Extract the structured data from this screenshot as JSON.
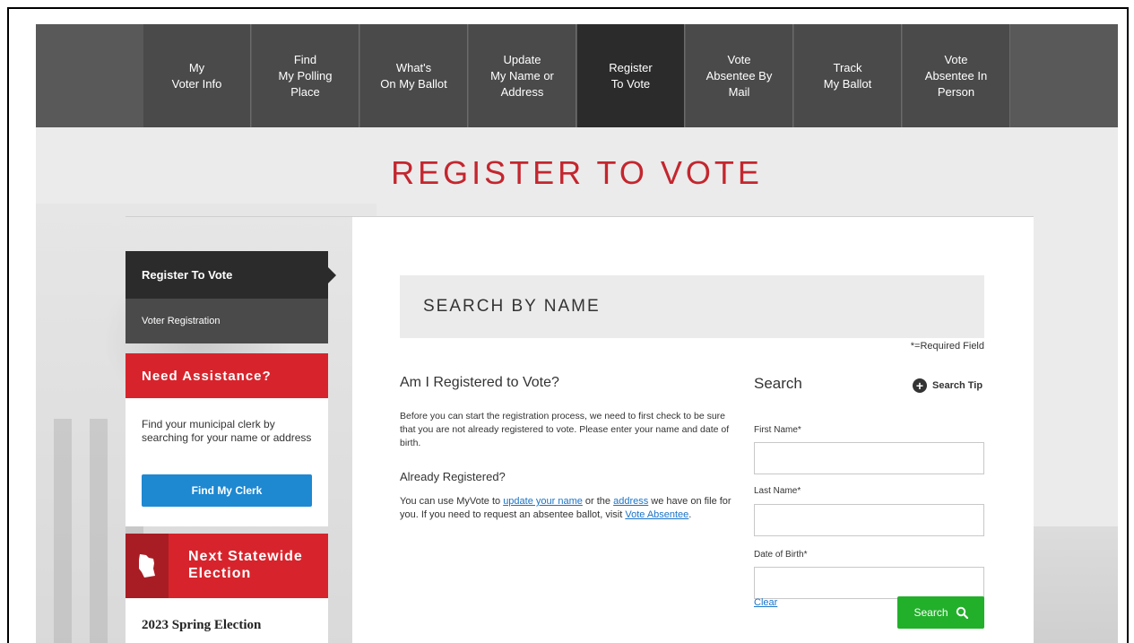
{
  "nav": [
    {
      "label": "My\nVoter Info",
      "active": false
    },
    {
      "label": "Find\nMy Polling\nPlace",
      "active": false
    },
    {
      "label": "What's\nOn My Ballot",
      "active": false
    },
    {
      "label": "Update\nMy Name or\nAddress",
      "active": false
    },
    {
      "label": "Register\nTo Vote",
      "active": true
    },
    {
      "label": "Vote\nAbsentee By\nMail",
      "active": false
    },
    {
      "label": "Track\nMy Ballot",
      "active": false
    },
    {
      "label": "Vote\nAbsentee In\nPerson",
      "active": false
    }
  ],
  "page_title": "REGISTER TO VOTE",
  "sidebar": {
    "active_item": "Register To Vote",
    "sub_item": "Voter Registration",
    "assistance": {
      "heading": "Need Assistance?",
      "text": "Find your municipal clerk by searching for your name or address",
      "button": "Find My Clerk"
    },
    "next_election": {
      "heading": "Next Statewide\nElection",
      "name": "2023 Spring Election"
    }
  },
  "main": {
    "section_heading": "SEARCH BY NAME",
    "required_note": "*=Required Field",
    "question_title": "Am I Registered to Vote?",
    "question_text": "Before you can start the registration process, we need to first check to be sure that you are not already registered to vote. Please enter your name and date of birth.",
    "already_title": "Already Registered?",
    "already_text": {
      "part1": "You can use MyVote to ",
      "link1": "update your name",
      "part2": " or the ",
      "link2": "address",
      "part3": " we have on file for you. If you need to request an absentee ballot, visit ",
      "link3": "Vote Absentee",
      "part4": "."
    },
    "search": {
      "title": "Search",
      "tip": "Search Tip",
      "first_name_label": "First Name*",
      "first_name_value": "",
      "last_name_label": "Last Name*",
      "last_name_value": "",
      "dob_label": "Date of Birth*",
      "dob_value": "",
      "clear": "Clear",
      "button": "Search"
    }
  }
}
